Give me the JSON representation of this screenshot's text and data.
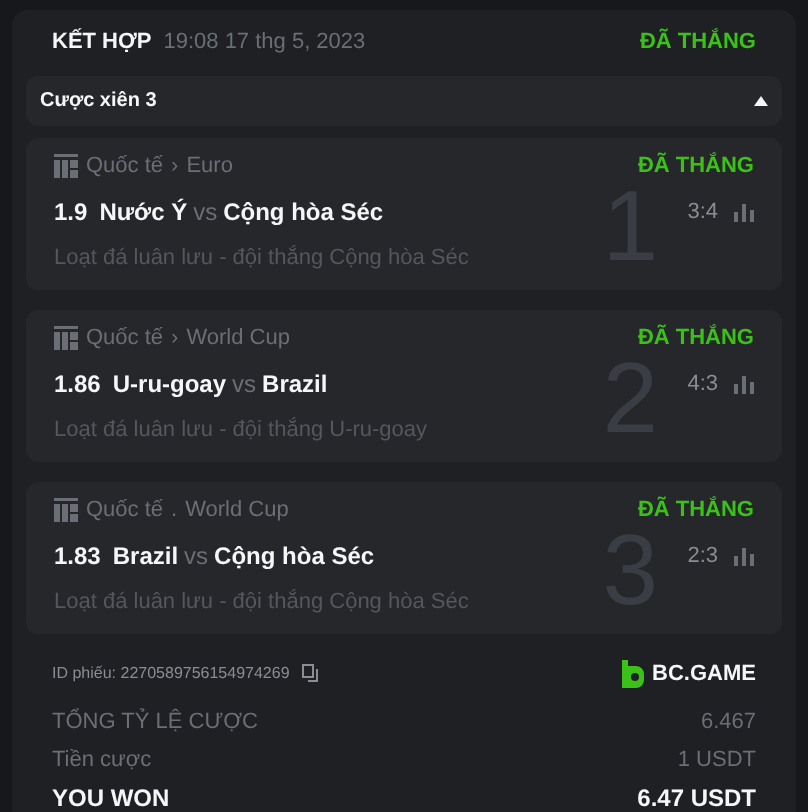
{
  "header": {
    "title": "KẾT HỢP",
    "datetime": "19:08 17 thg 5, 2023",
    "status": "ĐÃ THẮNG"
  },
  "parlay": {
    "label": "Cược xiên 3",
    "expanded": true
  },
  "matches": [
    {
      "league": "Quốc tế",
      "separator": "›",
      "competition": "Euro",
      "status": "ĐÃ THẮNG",
      "odds": "1.9",
      "home": "Nước Ý",
      "vs": "vs",
      "away": "Cộng hòa Séc",
      "score": "3:4",
      "detail": "Loạt đá luân lưu - đội thắng Cộng hòa Séc",
      "index": "1"
    },
    {
      "league": "Quốc tế",
      "separator": "›",
      "competition": "World Cup",
      "status": "ĐÃ THẮNG",
      "odds": "1.86",
      "home": "U-ru-goay",
      "vs": "vs",
      "away": "Brazil",
      "score": "4:3",
      "detail": "Loạt đá luân lưu - đội thắng U-ru-goay",
      "index": "2"
    },
    {
      "league": "Quốc tế",
      "separator": ".",
      "competition": "World Cup",
      "status": "ĐÃ THẮNG",
      "odds": "1.83",
      "home": "Brazil",
      "vs": "vs",
      "away": "Cộng hòa Séc",
      "score": "2:3",
      "detail": "Loạt đá luân lưu - đội thắng Cộng hòa Séc",
      "index": "3"
    }
  ],
  "ticket_id": "ID phiếu: 2270589756154974269",
  "brand": "BC.GAME",
  "totals": [
    {
      "label": "TỔNG TỶ LỆ CƯỢC",
      "value": "6.467",
      "kind": "muted"
    },
    {
      "label": "Tiền cược",
      "value": "1 USDT",
      "kind": "muted"
    },
    {
      "label": "YOU WON",
      "value": "6.47 USDT",
      "kind": "strong"
    }
  ]
}
